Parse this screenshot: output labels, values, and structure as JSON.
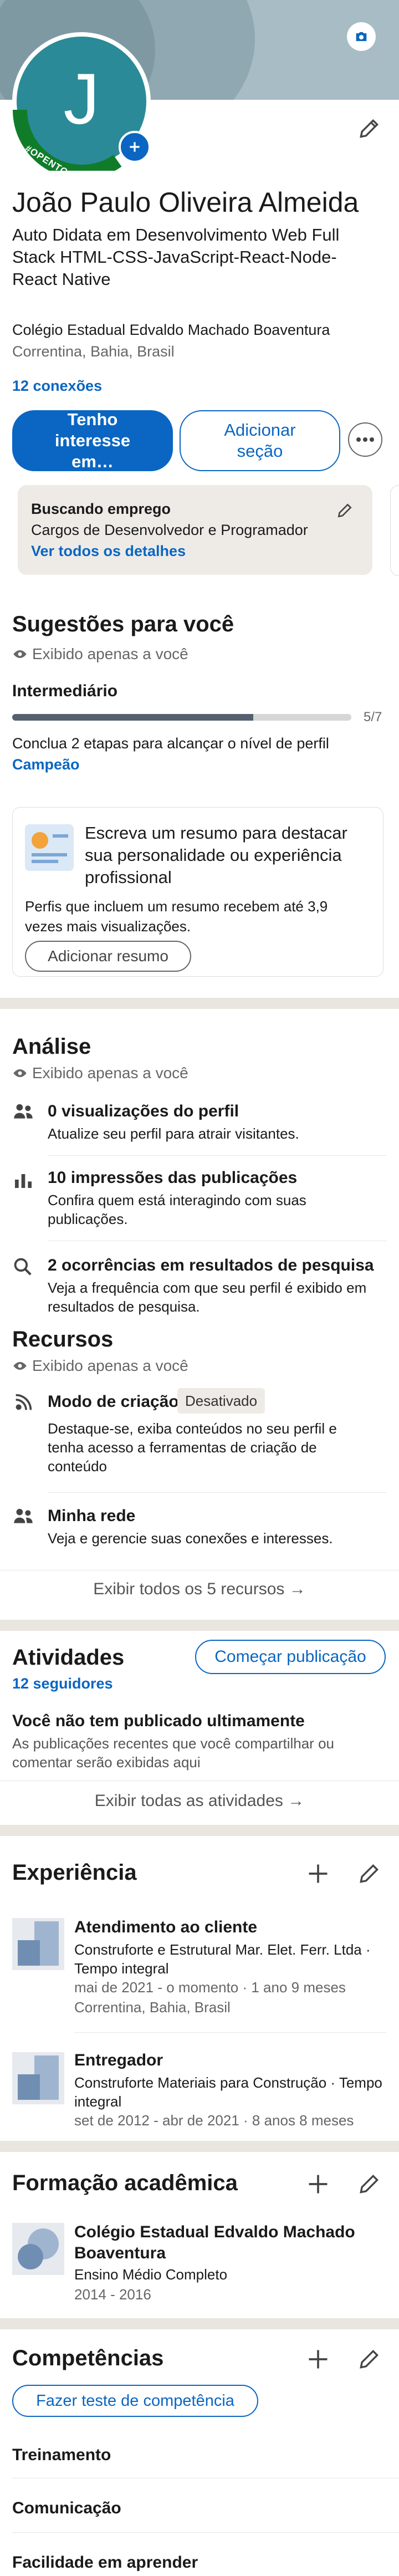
{
  "header": {
    "avatar_letter": "J",
    "open_to_work": "#OPENTOWORK",
    "name": "João Paulo Oliveira Almeida",
    "headline": "Auto Didata em Desenvolvimento Web Full Stack HTML-CSS-JavaScript-React-Node-React Native",
    "education": "Colégio Estadual Edvaldo Machado Boaventura",
    "location": "Correntina, Bahia, Brasil",
    "connections": "12 conexões",
    "btn_interested": "Tenho interesse em…",
    "btn_add_section": "Adicionar seção",
    "colors": {
      "primary": "#0a66c2",
      "open_to_work": "#107c2a"
    }
  },
  "job_card": {
    "title": "Buscando emprego",
    "roles": "Cargos de Desenvolvedor e Programador",
    "link": "Ver todos os detalhes"
  },
  "suggestions": {
    "title": "Sugestões para você",
    "visibility": "Exibido apenas a você",
    "level": "Intermediário",
    "progress_label": "5/7",
    "progress_value": 0.71,
    "hint": "Conclua 2 etapas para alcançar o nível de perfil",
    "hint_level": "Campeão",
    "summary_title": "Escreva um resumo para destacar sua personalidade ou experiência profissional",
    "summary_desc": "Perfis que incluem um resumo recebem até 3,9 vezes mais visualizações.",
    "summary_btn": "Adicionar resumo"
  },
  "analysis": {
    "title": "Análise",
    "visibility": "Exibido apenas a você",
    "items": [
      {
        "title": "0 visualizações do perfil",
        "desc": "Atualize seu perfil para atrair visitantes."
      },
      {
        "title": "10 impressões das publicações",
        "desc": "Confira quem está interagindo com suas publicações."
      },
      {
        "title": "2 ocorrências em resultados de pesquisa",
        "desc": "Veja a frequência com que seu perfil é exibido em resultados de pesquisa."
      }
    ]
  },
  "resources": {
    "title": "Recursos",
    "visibility": "Exibido apenas a você",
    "creator_title": "Modo de criação",
    "creator_badge": "Desativado",
    "creator_desc": "Destaque-se, exiba conteúdos no seu perfil e tenha acesso a ferramentas de criação de conteúdo",
    "network_title": "Minha rede",
    "network_desc": "Veja e gerencie suas conexões e interesses.",
    "show_all": "Exibir todos os 5 recursos →"
  },
  "activity": {
    "title": "Atividades",
    "followers": "12 seguidores",
    "start_post": "Começar publicação",
    "empty_title": "Você não tem publicado ultimamente",
    "empty_desc": "As publicações recentes que você compartilhar ou comentar serão exibidas aqui",
    "show_all": "Exibir todas as atividades →"
  },
  "experience": {
    "title": "Experiência",
    "items": [
      {
        "role": "Atendimento ao cliente",
        "company": "Construforte e Estrutural Mar. Elet. Ferr. Ltda · Tempo integral",
        "dates": "mai de 2021 - o momento · 1 ano 9 meses",
        "location": "Correntina, Bahia, Brasil"
      },
      {
        "role": "Entregador",
        "company": "Construforte Materiais para Construção · Tempo integral",
        "dates": "set de 2012 - abr de 2021 · 8 anos 8 meses",
        "location": ""
      }
    ]
  },
  "education": {
    "title": "Formação acadêmica",
    "school": "Colégio Estadual Edvaldo Machado Boaventura",
    "degree": "Ensino Médio Completo",
    "years": "2014 - 2016"
  },
  "skills": {
    "title": "Competências",
    "test_btn": "Fazer teste de competência",
    "items": [
      "Treinamento",
      "Comunicação",
      "Facilidade em aprender"
    ]
  }
}
